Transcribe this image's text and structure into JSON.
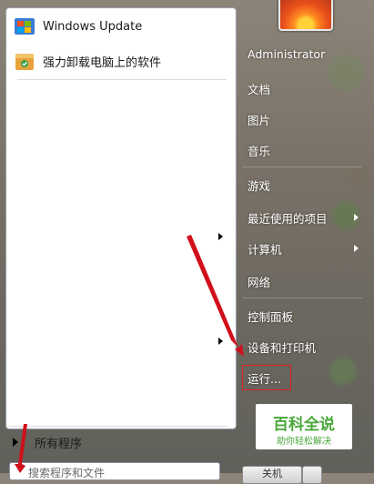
{
  "start_menu": {
    "pinned_programs": [
      {
        "label": "Windows Update",
        "icon": "windows-update-icon"
      },
      {
        "label": "强力卸载电脑上的软件",
        "icon": "uninstall-box-icon"
      }
    ],
    "all_programs_label": "所有程序",
    "search_placeholder": "搜索程序和文件"
  },
  "right_panel": {
    "items": [
      {
        "label": "Administrator",
        "has_arrow": false
      },
      {
        "label": "文档",
        "has_arrow": false
      },
      {
        "label": "图片",
        "has_arrow": false
      },
      {
        "label": "音乐",
        "has_arrow": false
      },
      {
        "label": "游戏",
        "has_arrow": false
      },
      {
        "label": "最近使用的项目",
        "has_arrow": true
      },
      {
        "label": "计算机",
        "has_arrow": true
      },
      {
        "label": "网络",
        "has_arrow": false
      },
      {
        "label": "控制面板",
        "has_arrow": false
      },
      {
        "label": "设备和打印机",
        "has_arrow": false
      },
      {
        "label": "运行...",
        "has_arrow": false
      }
    ],
    "shutdown_label": "关机"
  },
  "watermark": {
    "title": "百科全说",
    "subtitle": "助你轻松解决"
  },
  "colors": {
    "highlight_red": "#e02020",
    "watermark_green": "#4aa83a"
  }
}
